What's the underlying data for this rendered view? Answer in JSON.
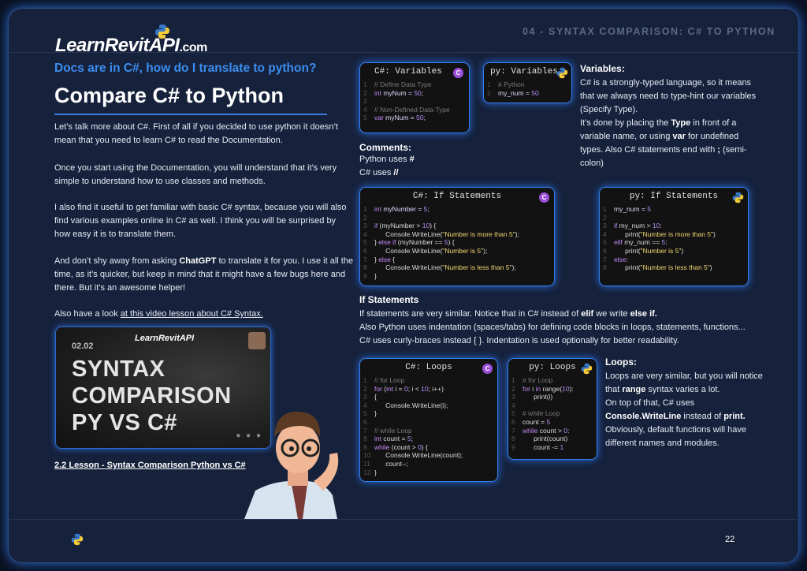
{
  "header": {
    "logo_main": "LearnRevitAPI",
    "logo_tld": ".com",
    "section": "04 - SYNTAX COMPARISON: C# TO PYTHON"
  },
  "left": {
    "kicker": "Docs are in C#, how do I translate to python?",
    "title": "Compare C# to Python",
    "p1": "Let’s talk more about C#. First of all if you decided to use python it doesn’t mean that you need to learn C# to read the Documentation.",
    "p2": "Once you start using the Documentation, you will understand that it’s very simple to understand how to use classes and methods.",
    "p3": "I also find it useful to get familiar with basic C# syntax, because you will also find various examples online in C# as well. I think you will be surprised by how easy it is to translate them.",
    "p4_pre": "And don’t shy away from asking ",
    "p4_bold": "ChatGPT",
    "p4_post": " to translate it for you. I use it all the time, as it’s quicker, but keep in mind that it might have a few bugs here and there. But it’s an awesome helper!",
    "p5_pre": "Also have a look ",
    "p5_link": "at this video lesson about C# Syntax.",
    "video": {
      "number": "02.02",
      "brand": "LearnRevitAPI",
      "title_lines": [
        "SYNTAX",
        "COMPARISON",
        "PY VS C#"
      ]
    },
    "caption": "2.2 Lesson - Syntax Comparison Python vs C#"
  },
  "variables": {
    "cs_title": "C#: Variables",
    "cs_code": [
      [
        {
          "t": "// Define Data Type",
          "c": "#7a7a7a"
        }
      ],
      [
        {
          "t": "int ",
          "c": "#c58af9"
        },
        {
          "t": "myNum = ",
          "c": "#d8d8ff"
        },
        {
          "t": "50",
          "c": "#b48cf5"
        },
        {
          "t": ";",
          "c": "#ddd"
        }
      ],
      [],
      [
        {
          "t": "// Non-Defined Data Type",
          "c": "#7a7a7a"
        }
      ],
      [
        {
          "t": "var ",
          "c": "#c58af9"
        },
        {
          "t": "myNum = ",
          "c": "#d8d8ff"
        },
        {
          "t": "50",
          "c": "#b48cf5"
        },
        {
          "t": ";",
          "c": "#ddd"
        }
      ]
    ],
    "py_title": "py: Variables",
    "py_code": [
      [
        {
          "t": "# Python",
          "c": "#7a7a7a"
        }
      ],
      [
        {
          "t": "my_num = ",
          "c": "#d8d8ff"
        },
        {
          "t": "50",
          "c": "#b48cf5"
        }
      ]
    ],
    "heading": "Variables:",
    "t1_pre": "C# is a strongly-typed language, so it means that we always need to type-hint our variables (Specify Type).",
    "t2_pre": "It’s done by placing the ",
    "t2_b1": "Type",
    "t2_mid": " in front of a variable name, or using ",
    "t2_b2": "var",
    "t2_mid2": " for undefined types. Also C# statements end with ",
    "t2_b3": ";",
    "t2_post": " (semi-colon)"
  },
  "comments": {
    "heading": "Comments:",
    "line1_pre": "Python uses ",
    "line1_b": "#",
    "line2_pre": "C# uses ",
    "line2_b": "//"
  },
  "ifs": {
    "cs_title": "C#: If Statements",
    "cs_code": [
      [
        {
          "t": "int ",
          "c": "#c58af9"
        },
        {
          "t": "myNumber = ",
          "c": "#d8d8ff"
        },
        {
          "t": "5",
          "c": "#b48cf5"
        },
        {
          "t": ";",
          "c": "#ddd"
        }
      ],
      [],
      [
        {
          "t": "if ",
          "c": "#c58af9"
        },
        {
          "t": "(myNumber > ",
          "c": "#ddd"
        },
        {
          "t": "10",
          "c": "#b48cf5"
        },
        {
          "t": ") {",
          "c": "#ddd"
        }
      ],
      [
        {
          "t": "      Console.WriteLine(",
          "c": "#ddd"
        },
        {
          "t": "\"Number is more than 5\"",
          "c": "#f3d774"
        },
        {
          "t": ");",
          "c": "#ddd"
        }
      ],
      [
        {
          "t": "} ",
          "c": "#ddd"
        },
        {
          "t": "else if ",
          "c": "#c58af9"
        },
        {
          "t": "(myNumber == ",
          "c": "#ddd"
        },
        {
          "t": "5",
          "c": "#b48cf5"
        },
        {
          "t": ") {",
          "c": "#ddd"
        }
      ],
      [
        {
          "t": "      Console.WriteLine(",
          "c": "#ddd"
        },
        {
          "t": "\"Number is 5\"",
          "c": "#f3d774"
        },
        {
          "t": ");",
          "c": "#ddd"
        }
      ],
      [
        {
          "t": "} ",
          "c": "#ddd"
        },
        {
          "t": "else ",
          "c": "#c58af9"
        },
        {
          "t": "{",
          "c": "#ddd"
        }
      ],
      [
        {
          "t": "      Console.WriteLine(",
          "c": "#ddd"
        },
        {
          "t": "\"Number is less than 5\"",
          "c": "#f3d774"
        },
        {
          "t": ");",
          "c": "#ddd"
        }
      ],
      [
        {
          "t": "}",
          "c": "#ddd"
        }
      ]
    ],
    "py_title": "py: If Statements",
    "py_code": [
      [
        {
          "t": "my_num = ",
          "c": "#d8d8ff"
        },
        {
          "t": "5",
          "c": "#b48cf5"
        }
      ],
      [],
      [
        {
          "t": "if ",
          "c": "#c58af9"
        },
        {
          "t": "my_num > ",
          "c": "#ddd"
        },
        {
          "t": "10",
          "c": "#b48cf5"
        },
        {
          "t": ":",
          "c": "#ddd"
        }
      ],
      [
        {
          "t": "      print(",
          "c": "#ddd"
        },
        {
          "t": "\"Number is more than 5\"",
          "c": "#f3d774"
        },
        {
          "t": ")",
          "c": "#ddd"
        }
      ],
      [
        {
          "t": "elif ",
          "c": "#c58af9"
        },
        {
          "t": "my_num == ",
          "c": "#ddd"
        },
        {
          "t": "5",
          "c": "#b48cf5"
        },
        {
          "t": ":",
          "c": "#ddd"
        }
      ],
      [
        {
          "t": "      print(",
          "c": "#ddd"
        },
        {
          "t": "\"Number is 5\"",
          "c": "#f3d774"
        },
        {
          "t": ")",
          "c": "#ddd"
        }
      ],
      [
        {
          "t": "else",
          "c": "#c58af9"
        },
        {
          "t": ":",
          "c": "#ddd"
        }
      ],
      [
        {
          "t": "      print(",
          "c": "#ddd"
        },
        {
          "t": "\"Number is less than 5\"",
          "c": "#f3d774"
        },
        {
          "t": ")",
          "c": "#ddd"
        }
      ]
    ],
    "heading": "If Statements",
    "t1_pre": "If statements are very similar. Notice that in C# instead of ",
    "t1_b1": "elif",
    "t1_mid": " we write ",
    "t1_b2": "else if.",
    "t2": "Also Python uses indentation (spaces/tabs) for defining code blocks in loops, statements, functions... C# uses curly-braces instead { }. Indentation is used optionally for better readability."
  },
  "loops": {
    "cs_title": "C#: Loops",
    "cs_code": [
      [
        {
          "t": "// for Loop",
          "c": "#7a7a7a"
        }
      ],
      [
        {
          "t": "for ",
          "c": "#c58af9"
        },
        {
          "t": "(",
          "c": "#ddd"
        },
        {
          "t": "int ",
          "c": "#c58af9"
        },
        {
          "t": "i = ",
          "c": "#ddd"
        },
        {
          "t": "0",
          "c": "#b48cf5"
        },
        {
          "t": "; i < ",
          "c": "#ddd"
        },
        {
          "t": "10",
          "c": "#b48cf5"
        },
        {
          "t": "; i++)",
          "c": "#ddd"
        }
      ],
      [
        {
          "t": "{",
          "c": "#ddd"
        }
      ],
      [
        {
          "t": "      Console.WriteLine(i);",
          "c": "#ddd"
        }
      ],
      [
        {
          "t": "}",
          "c": "#ddd"
        }
      ],
      [],
      [
        {
          "t": "// while Loop",
          "c": "#7a7a7a"
        }
      ],
      [
        {
          "t": "int ",
          "c": "#c58af9"
        },
        {
          "t": "count = ",
          "c": "#ddd"
        },
        {
          "t": "5",
          "c": "#b48cf5"
        },
        {
          "t": ";",
          "c": "#ddd"
        }
      ],
      [
        {
          "t": "while ",
          "c": "#c58af9"
        },
        {
          "t": "(count > ",
          "c": "#ddd"
        },
        {
          "t": "0",
          "c": "#b48cf5"
        },
        {
          "t": ") {",
          "c": "#ddd"
        }
      ],
      [
        {
          "t": "      Console.WriteLine(count);",
          "c": "#ddd"
        }
      ],
      [
        {
          "t": "      count--;",
          "c": "#ddd"
        }
      ],
      [
        {
          "t": "}",
          "c": "#ddd"
        }
      ]
    ],
    "py_title": "py: Loops",
    "py_code": [
      [
        {
          "t": "# for Loop",
          "c": "#7a7a7a"
        }
      ],
      [
        {
          "t": "for ",
          "c": "#c58af9"
        },
        {
          "t": "i ",
          "c": "#ddd"
        },
        {
          "t": "in ",
          "c": "#c58af9"
        },
        {
          "t": "range(",
          "c": "#ddd"
        },
        {
          "t": "10",
          "c": "#b48cf5"
        },
        {
          "t": "):",
          "c": "#ddd"
        }
      ],
      [
        {
          "t": "      print(i)",
          "c": "#ddd"
        }
      ],
      [],
      [
        {
          "t": "# while Loop",
          "c": "#7a7a7a"
        }
      ],
      [
        {
          "t": "count = ",
          "c": "#ddd"
        },
        {
          "t": "5",
          "c": "#b48cf5"
        }
      ],
      [
        {
          "t": "while ",
          "c": "#c58af9"
        },
        {
          "t": "count > ",
          "c": "#ddd"
        },
        {
          "t": "0",
          "c": "#b48cf5"
        },
        {
          "t": ":",
          "c": "#ddd"
        }
      ],
      [
        {
          "t": "      print(count)",
          "c": "#ddd"
        }
      ],
      [
        {
          "t": "      count -= ",
          "c": "#ddd"
        },
        {
          "t": "1",
          "c": "#b48cf5"
        }
      ]
    ],
    "heading": "Loops:",
    "t1_pre": "Loops are very similar, but you will notice that ",
    "t1_b": "range",
    "t1_post": " syntax varies a lot.",
    "t2_pre": "On top of that, C# uses ",
    "t2_b1": "Console.WriteLine",
    "t2_mid": " instead of ",
    "t2_b2": "print.",
    "t3": "Obviously, default functions will have different names and modules."
  },
  "footer": {
    "page": "22"
  },
  "colors": {
    "accent": "#3c8ef0",
    "background": "#16213b",
    "code_bg": "#121212",
    "border": "#3380f0"
  }
}
